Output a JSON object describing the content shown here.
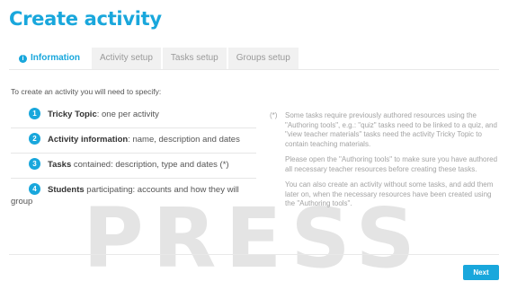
{
  "page": {
    "title": "Create activity"
  },
  "tabs": [
    {
      "label": "Information",
      "active": true,
      "icon": "info-icon"
    },
    {
      "label": "Activity setup",
      "active": false
    },
    {
      "label": "Tasks setup",
      "active": false
    },
    {
      "label": "Groups setup",
      "active": false
    }
  ],
  "intro": "To create an activity you will need to specify:",
  "steps": [
    {
      "number": "1",
      "bold": "Tricky Topic",
      "text": ": one per activity"
    },
    {
      "number": "2",
      "bold": "Activity information",
      "text": ": name, description and dates"
    },
    {
      "number": "3",
      "bold": "Tasks",
      "text": " contained: description, type and dates (*)"
    },
    {
      "number": "4",
      "bold": "Students",
      "text": " participating: accounts and how they will group"
    }
  ],
  "note": {
    "mark": "(*)",
    "paragraphs": [
      "Some tasks require previously authored resources using the \"Authoring tools\", e.g.: \"quiz\" tasks need to be linked to a quiz, and \"view teacher materials\" tasks need the activity Tricky Topic to contain teaching materials.",
      "Please open the \"Authoring tools\" to make sure you have authored all necessary teacher resources before creating these tasks.",
      "You can also create an activity without some tasks, and add them later on, when the necessary resources have been created using the \"Authoring tools\"."
    ]
  },
  "buttons": {
    "next": "Next"
  },
  "watermark": "PRESS",
  "colors": {
    "accent": "#19a7dc",
    "tab_bg": "#f1f1f1",
    "muted_text": "#a3a3a3"
  }
}
